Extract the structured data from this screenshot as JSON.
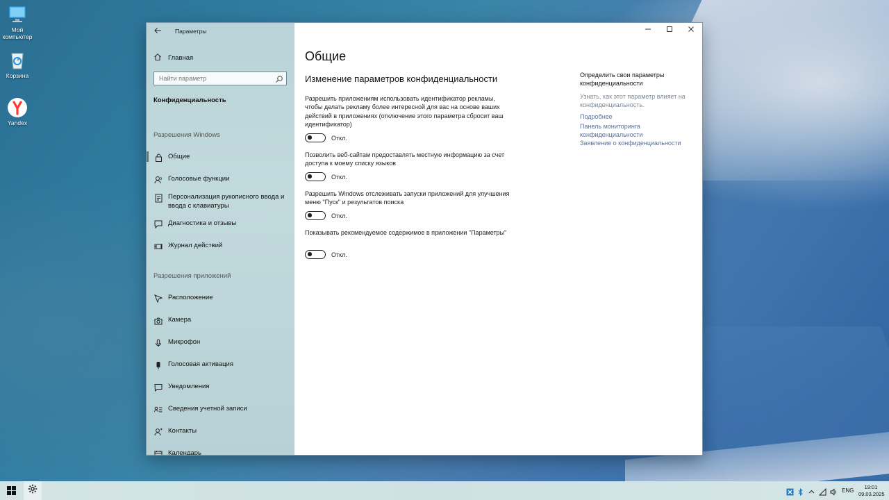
{
  "desktop": {
    "icons": [
      {
        "label": "Мой компьютер",
        "icon": "computer-icon"
      },
      {
        "label": "Корзина",
        "icon": "recycle-bin-icon"
      },
      {
        "label": "Yandex",
        "icon": "yandex-browser-icon"
      }
    ]
  },
  "window": {
    "title": "Параметры",
    "controls": {
      "minimize": "—",
      "maximize": "☐",
      "close": "✕"
    }
  },
  "sidebar": {
    "home_label": "Главная",
    "search_placeholder": "Найти параметр",
    "category_title": "Конфиденциальность",
    "section_windows": "Разрешения Windows",
    "windows_items": [
      {
        "label": "Общие",
        "icon": "lock-icon",
        "active": true
      },
      {
        "label": "Голосовые функции",
        "icon": "speech-icon"
      },
      {
        "label": "Персонализация рукописного ввода и ввода с клавиатуры",
        "icon": "handwriting-icon"
      },
      {
        "label": "Диагностика и отзывы",
        "icon": "feedback-icon"
      },
      {
        "label": "Журнал действий",
        "icon": "timeline-icon"
      }
    ],
    "section_apps": "Разрешения приложений",
    "app_items": [
      {
        "label": "Расположение",
        "icon": "location-icon"
      },
      {
        "label": "Камера",
        "icon": "camera-icon"
      },
      {
        "label": "Микрофон",
        "icon": "microphone-icon"
      },
      {
        "label": "Голосовая активация",
        "icon": "voice-activation-icon"
      },
      {
        "label": "Уведомления",
        "icon": "notification-icon"
      },
      {
        "label": "Сведения учетной записи",
        "icon": "account-info-icon"
      },
      {
        "label": "Контакты",
        "icon": "contacts-icon"
      },
      {
        "label": "Календарь",
        "icon": "calendar-icon"
      }
    ]
  },
  "main": {
    "title": "Общие",
    "subtitle": "Изменение параметров конфиденциальности",
    "options": [
      {
        "text": "Разрешить приложениям использовать идентификатор рекламы, чтобы делать рекламу более интересной для вас на основе ваших действий в приложениях (отключение этого параметра сбросит ваш идентификатор)",
        "state": "Откл."
      },
      {
        "text": "Позволить веб-сайтам предоставлять местную информацию за счет доступа к моему списку языков",
        "state": "Откл."
      },
      {
        "text": "Разрешить Windows отслеживать запуски приложений для улучшения меню \"Пуск\" и результатов поиска",
        "state": "Откл."
      },
      {
        "text": "Показывать рекомендуемое содержимое в приложении \"Параметры\"",
        "state": "Откл."
      }
    ],
    "right_panel": {
      "heading": "Определить свои параметры конфиденциальности",
      "muted_text": "Узнать, как этот параметр влияет на конфиденциальность.",
      "links": [
        "Подробнее",
        "Панель мониторинга конфиденциальности",
        "Заявление о конфиденциальности"
      ]
    }
  },
  "taskbar": {
    "lang": "ENG",
    "time": "19:01",
    "date": "09.03.2025"
  }
}
